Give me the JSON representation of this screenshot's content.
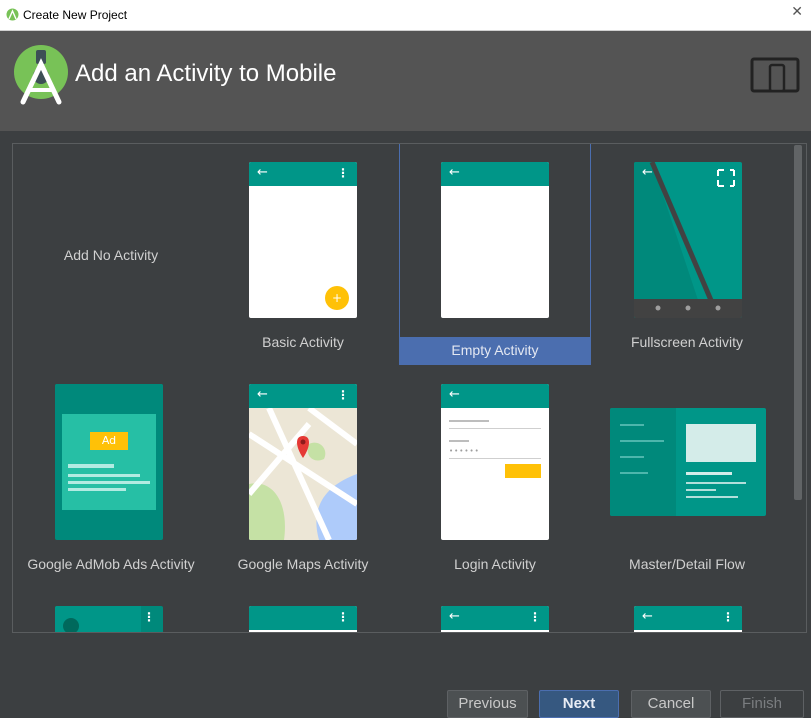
{
  "window": {
    "title": "Create New Project",
    "close_label": "✕"
  },
  "header": {
    "title": "Add an Activity to Mobile"
  },
  "colors": {
    "accent": "#009688",
    "selection": "#4b6eaf",
    "fab": "#ffc107"
  },
  "activities": [
    {
      "label": "Add No Activity"
    },
    {
      "label": "Basic Activity"
    },
    {
      "label": "Empty Activity",
      "selected": true
    },
    {
      "label": "Fullscreen Activity"
    },
    {
      "label": "Google AdMob Ads Activity",
      "badge": "Ad"
    },
    {
      "label": "Google Maps Activity"
    },
    {
      "label": "Login Activity"
    },
    {
      "label": "Master/Detail Flow"
    }
  ],
  "buttons": {
    "previous": "Previous",
    "next": "Next",
    "cancel": "Cancel",
    "finish": "Finish"
  }
}
